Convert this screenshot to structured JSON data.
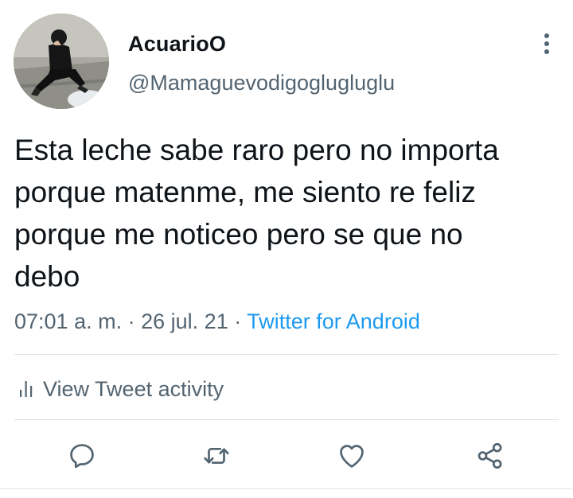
{
  "user": {
    "display_name": "AcuarioO",
    "handle": "@Mamaguevodigoglugluglu",
    "avatar_icon": "user-avatar-photo"
  },
  "tweet": {
    "text": "Esta leche sabe raro pero no importa\nporque matenme, me siento re feliz\nporque me noticeo pero se que no\ndebo",
    "time": "07:01 a. m.",
    "date": "26 jul. 21",
    "separator": "·",
    "source": "Twitter for Android"
  },
  "activity": {
    "label": "View Tweet activity",
    "icon": "bar-chart-icon"
  },
  "actions": {
    "reply_icon": "reply-icon",
    "retweet_icon": "retweet-icon",
    "like_icon": "heart-icon",
    "share_icon": "share-icon"
  },
  "colors": {
    "text": "#0f1419",
    "secondary": "#536471",
    "link": "#1d9bf0",
    "divider": "#dfe3e6"
  }
}
